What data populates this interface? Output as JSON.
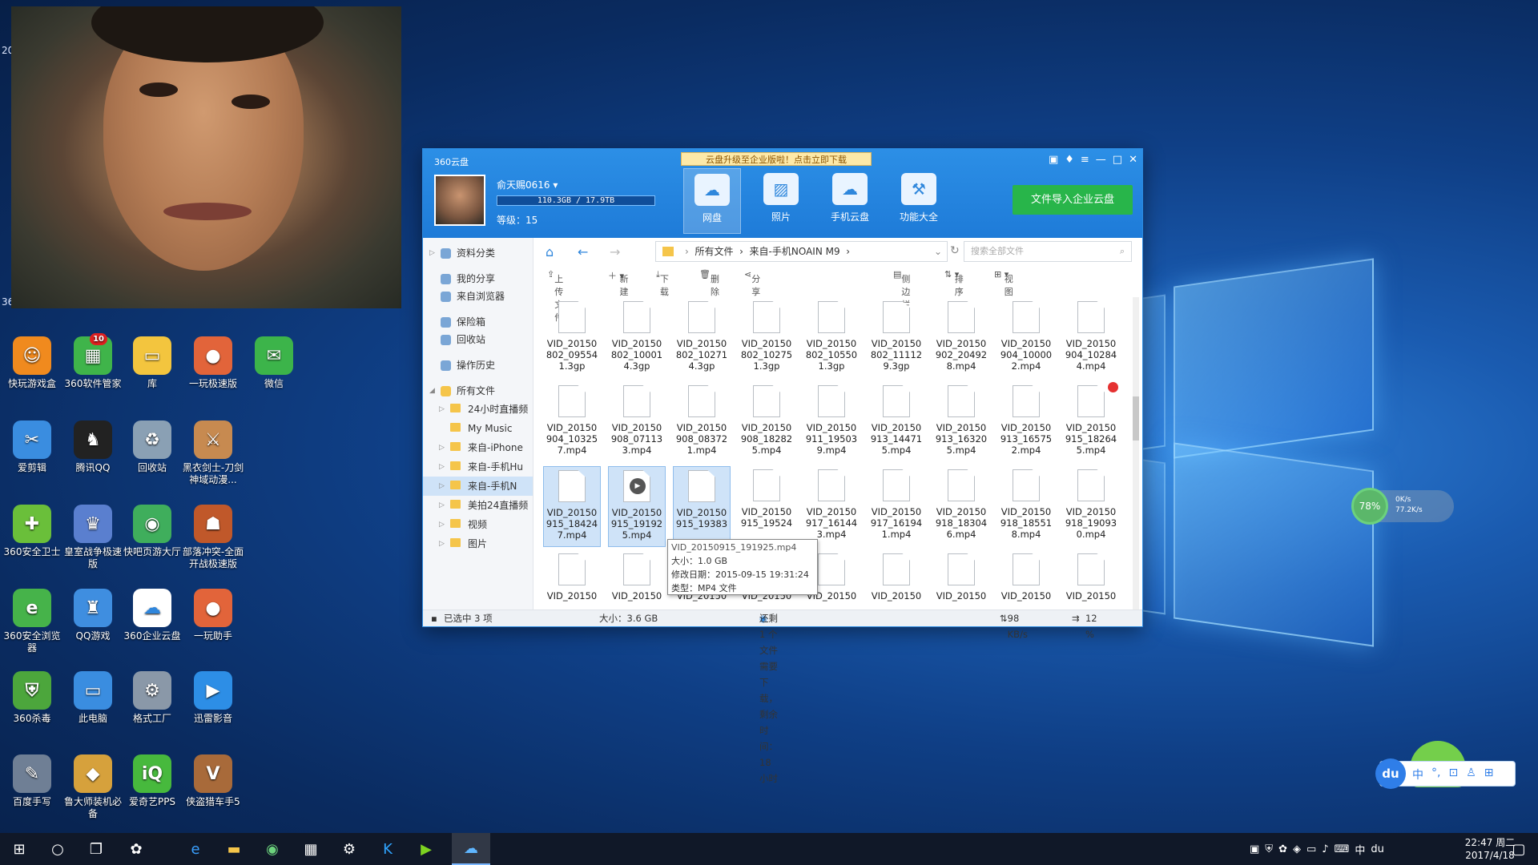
{
  "webcam": {
    "left_text_1": "20",
    "left_text_2": "36"
  },
  "desktop_icons": [
    {
      "label": "快玩游戏盒",
      "color": "#f08a1e",
      "glyph": "☺"
    },
    {
      "label": "360软件管家",
      "color": "#3fb44a",
      "glyph": "▦",
      "badge": "10"
    },
    {
      "label": "库",
      "color": "#f3c53e",
      "glyph": "▭"
    },
    {
      "label": "一玩极速版",
      "color": "#e2643a",
      "glyph": "●"
    },
    {
      "label": "微信",
      "color": "#3cb44a",
      "glyph": "✉"
    },
    {
      "label": "爱剪辑",
      "color": "#3a8de0",
      "glyph": "✂"
    },
    {
      "label": "腾讯QQ",
      "color": "#222222",
      "glyph": "♞"
    },
    {
      "label": "回收站",
      "color": "#8aa0b4",
      "glyph": "♻"
    },
    {
      "label": "黑衣剑士-刀剑神域动漫...",
      "color": "#c78a50",
      "glyph": "⚔"
    },
    {
      "label": "360安全卫士",
      "color": "#6abf3a",
      "glyph": "✚"
    },
    {
      "label": "皇室战争极速版",
      "color": "#5a7fcf",
      "glyph": "♛"
    },
    {
      "label": "快吧页游大厅",
      "color": "#3fae5c",
      "glyph": "◉"
    },
    {
      "label": "部落冲突-全面开战极速版",
      "color": "#c0582a",
      "glyph": "☗"
    },
    {
      "label": "360安全浏览器",
      "color": "#46b34a",
      "glyph": "e"
    },
    {
      "label": "QQ游戏",
      "color": "#3f8ee0",
      "glyph": "♜"
    },
    {
      "label": "360企业云盘",
      "color": "#ffffff",
      "glyph": "☁"
    },
    {
      "label": "一玩助手",
      "color": "#e2643a",
      "glyph": "●"
    },
    {
      "label": "360杀毒",
      "color": "#4ca63c",
      "glyph": "⛨"
    },
    {
      "label": "此电脑",
      "color": "#3a8de0",
      "glyph": "▭"
    },
    {
      "label": "格式工厂",
      "color": "#8a98a8",
      "glyph": "⚙"
    },
    {
      "label": "迅雷影音",
      "color": "#2d8ee6",
      "glyph": "▶"
    },
    {
      "label": "百度手写",
      "color": "#6f7f95",
      "glyph": "✎"
    },
    {
      "label": "鲁大师装机必备",
      "color": "#d6a13c",
      "glyph": "◆"
    },
    {
      "label": "爱奇艺PPS",
      "color": "#47b93d",
      "glyph": "iQ"
    },
    {
      "label": "侠盗猎车手5",
      "color": "#a86a3a",
      "glyph": "V"
    }
  ],
  "cloud": {
    "window_title": "360云盘",
    "ad_text": "云盘升级至企业版啦！点击立即下载",
    "username": "俞天赐0616",
    "quota_text": "110.3GB / 17.9TB",
    "quota_fraction": 0.006,
    "level": "等级：15",
    "tabs": [
      "网盘",
      "照片",
      "手机云盘",
      "功能大全"
    ],
    "import_button": "文件导入企业云盘",
    "sidebar": {
      "top_items": [
        "资料分类",
        "我的分享",
        "来自浏览器",
        "保险箱",
        "回收站",
        "操作历史"
      ],
      "all_files": "所有文件",
      "folders": [
        "24小时直播频",
        "My Music",
        "来自-iPhone",
        "来自-手机Hu",
        "来自-手机N",
        "美拍24直播频",
        "视频",
        "图片"
      ]
    },
    "breadcrumb": [
      "所有文件",
      "来自-手机NOAIN M9"
    ],
    "search_placeholder": "搜索全部文件",
    "toolbar": {
      "upload": "上传文件",
      "new": "新建",
      "download": "下载",
      "delete": "删除",
      "share": "分享",
      "sidebar_toggle": "侧边栏",
      "sort": "排序",
      "view": "视图"
    },
    "files": [
      [
        "VID_20150",
        "802_09554",
        "1.3gp"
      ],
      [
        "VID_20150",
        "802_10001",
        "4.3gp"
      ],
      [
        "VID_20150",
        "802_10271",
        "4.3gp"
      ],
      [
        "VID_20150",
        "802_10275",
        "1.3gp"
      ],
      [
        "VID_20150",
        "802_10550",
        "1.3gp"
      ],
      [
        "VID_20150",
        "802_11112",
        "9.3gp"
      ],
      [
        "VID_20150",
        "902_20492",
        "8.mp4"
      ],
      [
        "VID_20150",
        "904_10000",
        "2.mp4"
      ],
      [
        "VID_20150",
        "904_10284",
        "4.mp4"
      ],
      [
        "VID_20150",
        "904_10325",
        "7.mp4"
      ],
      [
        "VID_20150",
        "908_07113",
        "3.mp4"
      ],
      [
        "VID_20150",
        "908_08372",
        "1.mp4"
      ],
      [
        "VID_20150",
        "908_18282",
        "5.mp4"
      ],
      [
        "VID_20150",
        "911_19503",
        "9.mp4"
      ],
      [
        "VID_20150",
        "913_14471",
        "5.mp4"
      ],
      [
        "VID_20150",
        "913_16320",
        "5.mp4"
      ],
      [
        "VID_20150",
        "913_16575",
        "2.mp4"
      ],
      [
        "VID_20150",
        "915_18264",
        "5.mp4"
      ],
      [
        "VID_20150",
        "915_18424",
        "7.mp4"
      ],
      [
        "VID_20150",
        "915_19192",
        "5.mp4"
      ],
      [
        "VID_20150",
        "915_19383",
        ""
      ],
      [
        "VID_20150",
        "915_19524",
        ""
      ],
      [
        "VID_20150",
        "917_16144",
        "3.mp4"
      ],
      [
        "VID_20150",
        "917_16194",
        "1.mp4"
      ],
      [
        "VID_20150",
        "918_18304",
        "6.mp4"
      ],
      [
        "VID_20150",
        "918_18551",
        "8.mp4"
      ],
      [
        "VID_20150",
        "918_19093",
        "0.mp4"
      ],
      [
        "VID_20150",
        "",
        ""
      ],
      [
        "VID_20150",
        "",
        ""
      ],
      [
        "VID_20150",
        "",
        ""
      ],
      [
        "VID_20150",
        "",
        ""
      ],
      [
        "VID_20150",
        "",
        ""
      ],
      [
        "VID_20150",
        "",
        ""
      ],
      [
        "VID_20150",
        "",
        ""
      ],
      [
        "VID_20150",
        "",
        ""
      ],
      [
        "VID_20150",
        "",
        ""
      ]
    ],
    "tooltip": {
      "name": "VID_20150915_191925.mp4",
      "size": "大小：1.0 GB",
      "modified": "修改日期：2015-09-15 19:31:24",
      "type": "类型：MP4 文件"
    },
    "status": {
      "selected": "已选中 3 项",
      "size": "大小：3.6 GB",
      "download": "还剩 1 个文件需要下载，剩余时间：18小时",
      "speed": "98 KB/s",
      "percent": "12 %"
    }
  },
  "net_widget": {
    "percent": "78%",
    "up": "0K/s",
    "down": "77.2K/s"
  },
  "ime": {
    "logo": "du",
    "items": [
      "中",
      "°,",
      "⊡",
      "♙",
      "⊞"
    ]
  },
  "clock": {
    "time": "22:47 周二",
    "date": "2017/4/18"
  }
}
